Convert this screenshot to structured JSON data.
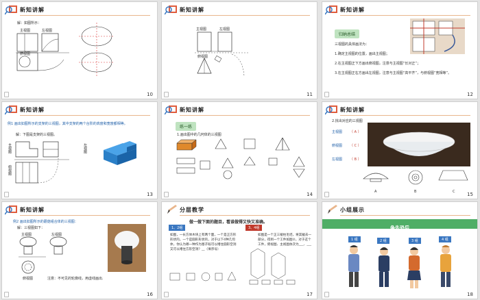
{
  "slides": [
    {
      "id": "10",
      "num": "10",
      "title": "新知讲解",
      "text": {
        "intro": "解：如图所示：",
        "front": "主视图",
        "left": "左视图",
        "top": "俯视图"
      }
    },
    {
      "id": "11",
      "num": "11",
      "title": "新知讲解",
      "text": {
        "front": "主视图",
        "left": "左视图",
        "top": "俯视图"
      }
    },
    {
      "id": "12",
      "num": "12",
      "title": "新知讲解",
      "text": {
        "badge": "归纳总结",
        "rules": "三视图的具体画法为：",
        "s1": "1.确定主视图的位置，画出主视图；",
        "s2": "2.在主视图正下方画出俯视图，注意与主视图“长对正”；",
        "s3": "3.在主视图正右方画出左视图，注意与主视图“高平齐”，与俯视图“宽相等”。"
      }
    },
    {
      "id": "13",
      "num": "13",
      "title": "新知讲解",
      "text": {
        "example": "例1 画出如图所示的支架的三视图，其中支架的两个台阶的高度和宽度都相等。",
        "answer": "解：下图是支架的三视图。",
        "front_v": "主视图",
        "left_v": "左视图",
        "top_v": "俯视图"
      }
    },
    {
      "id": "14",
      "num": "14",
      "title": "新知讲解",
      "text": {
        "practice": "练一练",
        "q1": "1.画出图中的几何体的三视图"
      }
    },
    {
      "id": "15",
      "num": "15",
      "title": "新知讲解",
      "text": {
        "q2": "2.找出对应的三视图",
        "front": "主视图",
        "top": "俯视图",
        "left": "左视图",
        "ans_front": "A",
        "ans_top": "C",
        "ans_left": "B",
        "opt_a": "A",
        "opt_b": "B",
        "opt_c": "C"
      }
    },
    {
      "id": "16",
      "num": "16",
      "title": "新知讲解",
      "text": {
        "example": "例2 画出如图所示的蘑菇组合体的三视图：",
        "answer": "解：三视图如下：",
        "front": "主视图",
        "left": "左视图",
        "top": "俯视图",
        "note": "注意：不可见的轮廓线，用虚线画出."
      }
    },
    {
      "id": "17",
      "num": "17",
      "title": "分层教学",
      "text": {
        "motto": "做一做下面的题目，看谁做得又快又准确。",
        "tier1": "1、2组",
        "tier2": "3、4组",
        "p1": "如图，一长方体木块上有两个面，一个是正方形形状的，一个是圆形形状的，对于以下4种几何体，你认为哪一种作为塞子既可以堵住圆形空洞又可以堵住方形空洞？__（填序号）",
        "p2": "如图是一个正三棱柱毛坯，将其截去一部分，得到一个工件如图②，对于这个工件，俯视图、主视图依次为___、___"
      }
    },
    {
      "id": "18",
      "num": "18",
      "title": "小组展示",
      "text": {
        "banner": "争先恐后",
        "g1": "1 组",
        "g2": "2 组",
        "g3": "3 组",
        "g4": "4 组"
      }
    }
  ],
  "colors": {
    "accent": "#e9b68c",
    "blue": "#3a77c1",
    "green_banner": "#4fae66",
    "red": "#c0392b"
  }
}
